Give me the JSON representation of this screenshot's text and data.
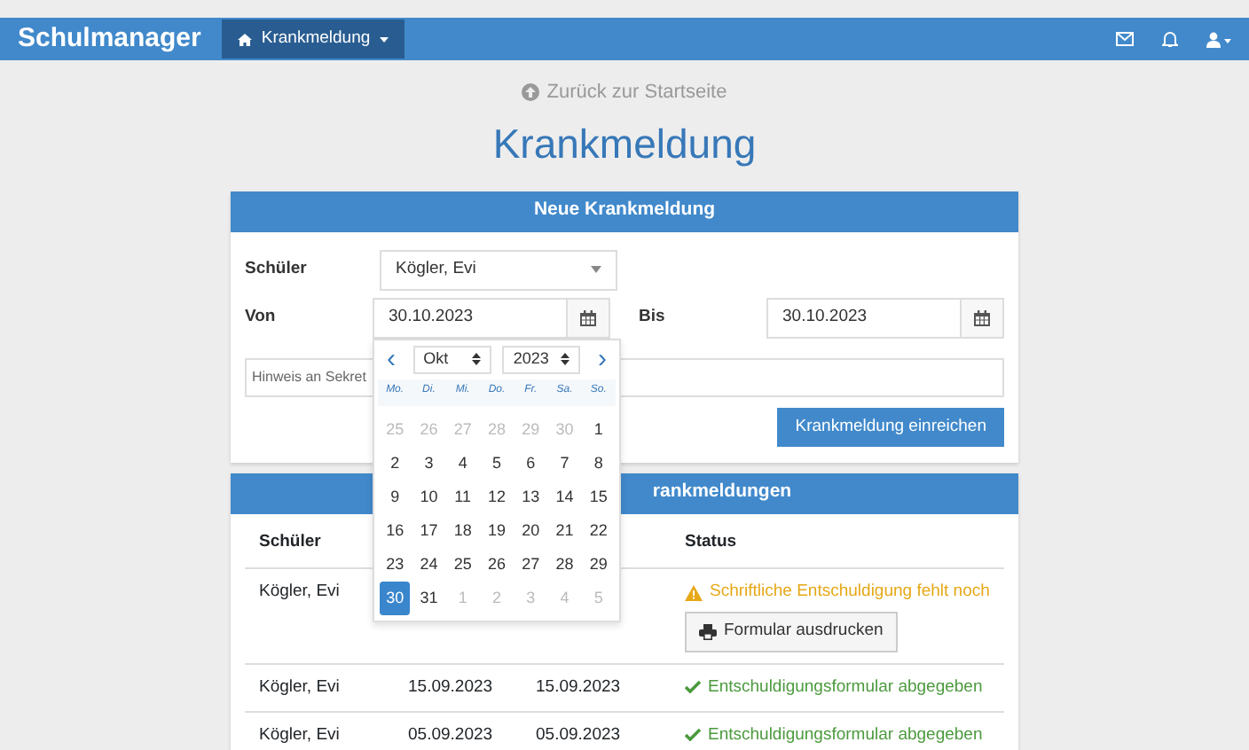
{
  "navbar": {
    "brand": "Schulmanager",
    "menu": {
      "label": "Krankmeldung"
    }
  },
  "back_link": "Zurück zur Startseite",
  "title": "Krankmeldung",
  "form_card": {
    "title": "Neue Krankmeldung",
    "student_label": "Schüler",
    "student_value": "Kögler, Evi",
    "from_label": "Von",
    "from_value": "30.10.2023",
    "to_label": "Bis",
    "to_value": "30.10.2023",
    "note": {
      "placeholder": "Hinweis an Sekret"
    },
    "submit": "Krankmeldung einreichen"
  },
  "datepicker": {
    "prev": "‹",
    "next": "›",
    "month": "Okt",
    "year": "2023",
    "weekdays": [
      "Mo.",
      "Di.",
      "Mi.",
      "Do.",
      "Fr.",
      "Sa.",
      "So."
    ],
    "days": [
      {
        "label": "25",
        "kind": "other",
        "selected": false
      },
      {
        "label": "26",
        "kind": "other",
        "selected": false
      },
      {
        "label": "27",
        "kind": "other",
        "selected": false
      },
      {
        "label": "28",
        "kind": "other",
        "selected": false
      },
      {
        "label": "29",
        "kind": "other",
        "selected": false
      },
      {
        "label": "30",
        "kind": "other",
        "selected": false
      },
      {
        "label": "1",
        "kind": "current",
        "selected": false
      },
      {
        "label": "2",
        "kind": "current",
        "selected": false
      },
      {
        "label": "3",
        "kind": "current",
        "selected": false
      },
      {
        "label": "4",
        "kind": "current",
        "selected": false
      },
      {
        "label": "5",
        "kind": "current",
        "selected": false
      },
      {
        "label": "6",
        "kind": "current",
        "selected": false
      },
      {
        "label": "7",
        "kind": "current",
        "selected": false
      },
      {
        "label": "8",
        "kind": "current",
        "selected": false
      },
      {
        "label": "9",
        "kind": "current",
        "selected": false
      },
      {
        "label": "10",
        "kind": "current",
        "selected": false
      },
      {
        "label": "11",
        "kind": "current",
        "selected": false
      },
      {
        "label": "12",
        "kind": "current",
        "selected": false
      },
      {
        "label": "13",
        "kind": "current",
        "selected": false
      },
      {
        "label": "14",
        "kind": "current",
        "selected": false
      },
      {
        "label": "15",
        "kind": "current",
        "selected": false
      },
      {
        "label": "16",
        "kind": "current",
        "selected": false
      },
      {
        "label": "17",
        "kind": "current",
        "selected": false
      },
      {
        "label": "18",
        "kind": "current",
        "selected": false
      },
      {
        "label": "19",
        "kind": "current",
        "selected": false
      },
      {
        "label": "20",
        "kind": "current",
        "selected": false
      },
      {
        "label": "21",
        "kind": "current",
        "selected": false
      },
      {
        "label": "22",
        "kind": "current",
        "selected": false
      },
      {
        "label": "23",
        "kind": "current",
        "selected": false
      },
      {
        "label": "24",
        "kind": "current",
        "selected": false
      },
      {
        "label": "25",
        "kind": "current",
        "selected": false
      },
      {
        "label": "26",
        "kind": "current",
        "selected": false
      },
      {
        "label": "27",
        "kind": "current",
        "selected": false
      },
      {
        "label": "28",
        "kind": "current",
        "selected": false
      },
      {
        "label": "29",
        "kind": "current",
        "selected": false
      },
      {
        "label": "30",
        "kind": "current",
        "selected": true
      },
      {
        "label": "31",
        "kind": "current",
        "selected": false
      },
      {
        "label": "1",
        "kind": "other",
        "selected": false
      },
      {
        "label": "2",
        "kind": "other",
        "selected": false
      },
      {
        "label": "3",
        "kind": "other",
        "selected": false
      },
      {
        "label": "4",
        "kind": "other",
        "selected": false
      },
      {
        "label": "5",
        "kind": "other",
        "selected": false
      }
    ]
  },
  "list_card": {
    "title": "rankmeldungen",
    "columns": [
      "Schüler",
      null,
      null,
      "Status"
    ],
    "rows": [
      {
        "student": "Kögler, Evi",
        "from": null,
        "to": null,
        "status": {
          "kind": "warning",
          "text": "Schriftliche Entschuldigung fehlt noch"
        },
        "action": "Formular ausdrucken"
      },
      {
        "student": "Kögler, Evi",
        "from": "15.09.2023",
        "to": "15.09.2023",
        "status": {
          "kind": "ok",
          "text": "Entschuldigungsformular abgegeben"
        }
      },
      {
        "student": "Kögler, Evi",
        "from": "05.09.2023",
        "to": "05.09.2023",
        "status": {
          "kind": "ok",
          "text": "Entschuldigungsformular abgegeben"
        }
      }
    ]
  }
}
